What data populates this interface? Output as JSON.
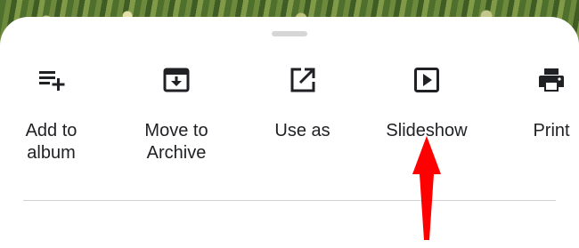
{
  "sheet": {
    "actions": [
      {
        "label": "Add to\nalbum",
        "icon": "playlist-add-icon"
      },
      {
        "label": "Move to\nArchive",
        "icon": "archive-icon"
      },
      {
        "label": "Use as",
        "icon": "open-in-new-icon"
      },
      {
        "label": "Slideshow",
        "icon": "slideshow-icon"
      },
      {
        "label": "Print",
        "icon": "print-icon"
      }
    ]
  },
  "annotation": {
    "arrow_color": "#ff0000",
    "points_to": "Slideshow"
  },
  "colors": {
    "text": "#202124",
    "sheet": "#ffffff",
    "handle": "#d6d6d6"
  }
}
